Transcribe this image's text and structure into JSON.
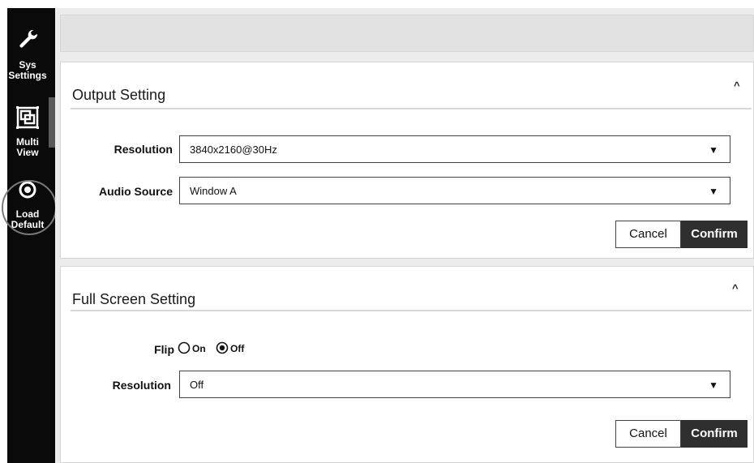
{
  "sidebar": {
    "items": [
      {
        "label_line1": "Sys",
        "label_line2": "Settings",
        "icon": "wrench-icon"
      },
      {
        "label_line1": "Multi",
        "label_line2": "View",
        "icon": "multiview-icon"
      },
      {
        "label_line1": "Load",
        "label_line2": "Default",
        "icon": "record-icon"
      }
    ]
  },
  "output_setting": {
    "title": "Output Setting",
    "collapse_glyph": "^",
    "resolution_label": "Resolution",
    "resolution_value": "3840x2160@30Hz",
    "audio_label": "Audio Source",
    "audio_value": "Window A",
    "cancel_label": "Cancel",
    "confirm_label": "Confirm"
  },
  "full_screen_setting": {
    "title": "Full Screen Setting",
    "collapse_glyph": "^",
    "flip_label": "Flip",
    "flip_on_label": "On",
    "flip_off_label": "Off",
    "flip_selected": "Off",
    "resolution_label": "Resolution",
    "resolution_value": "Off",
    "cancel_label": "Cancel",
    "confirm_label": "Confirm"
  },
  "dropdown_arrow": "▼",
  "colors": {
    "sidebar_bg": "#0a0a0a",
    "confirm_bg": "#2f2f2f",
    "panel_bg": "#ffffff",
    "app_bg": "#ececec"
  }
}
